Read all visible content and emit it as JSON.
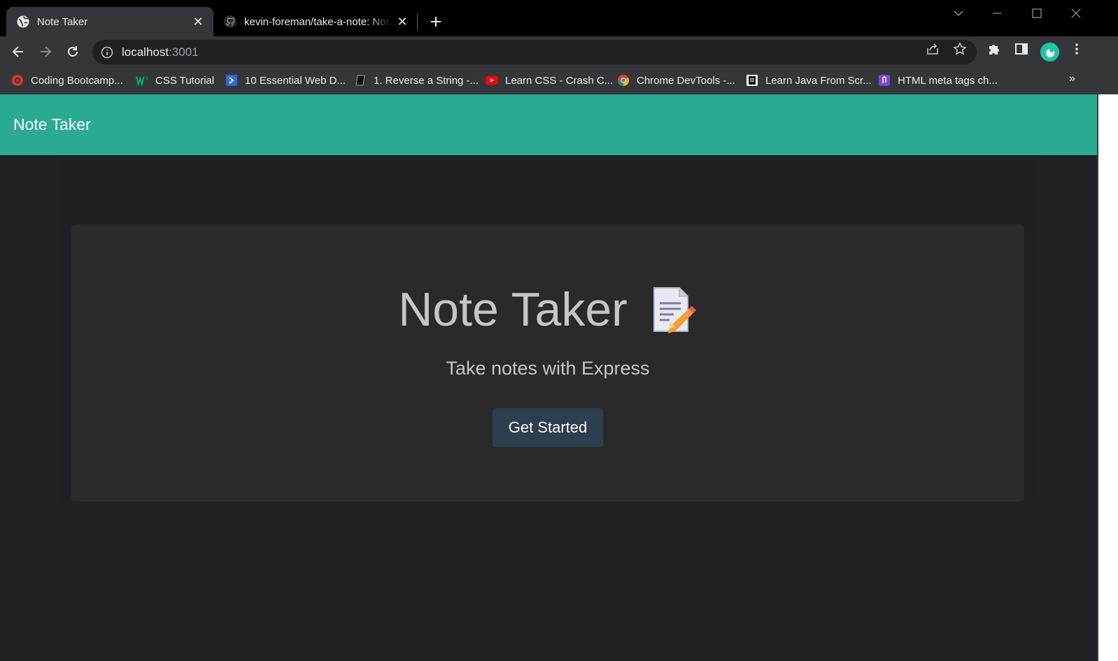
{
  "browser": {
    "tabs": [
      {
        "title": "Note Taker",
        "favicon": "globe-icon",
        "active": true
      },
      {
        "title": "kevin-foreman/take-a-note: Note",
        "favicon": "github-icon",
        "active": false
      }
    ],
    "url_host": "localhost",
    "url_port": ":3001",
    "bookmarks": [
      {
        "label": "Coding Bootcamp...",
        "icon": "bootcamp-icon"
      },
      {
        "label": "CSS Tutorial",
        "icon": "w3schools-icon"
      },
      {
        "label": "10 Essential Web D...",
        "icon": "bookmark-blue-icon"
      },
      {
        "label": "1. Reverse a String -...",
        "icon": "book-icon"
      },
      {
        "label": "Learn CSS - Crash C...",
        "icon": "youtube-icon"
      },
      {
        "label": "Chrome DevTools -...",
        "icon": "chrome-icon"
      },
      {
        "label": "Learn Java From Scr...",
        "icon": "course-icon"
      },
      {
        "label": "HTML meta tags ch...",
        "icon": "clip-icon"
      }
    ],
    "bookmarks_overflow": "»"
  },
  "app": {
    "brand": "Note Taker",
    "hero_title": "Note Taker",
    "hero_subtitle": "Take notes with Express",
    "cta_label": "Get Started"
  },
  "colors": {
    "navbar": "#2baa93",
    "background": "#202124",
    "jumbotron": "#2a2a2b",
    "button": "#2c3e50"
  }
}
